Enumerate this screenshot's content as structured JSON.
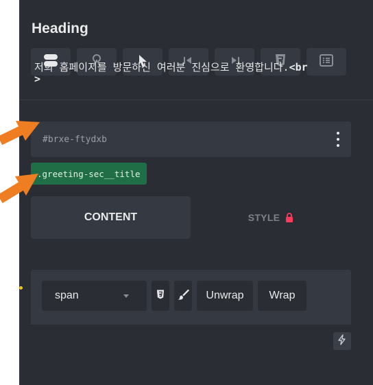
{
  "panel": {
    "heading": "Heading",
    "toolbar_icons": [
      "toggle-icon",
      "hook-icon",
      "cursor-icon",
      "skip-back-icon",
      "skip-forward-icon",
      "css3-icon",
      "list-icon"
    ]
  },
  "element": {
    "id": "#brxe-ftydxb",
    "class_name": ".greeting-sec__title"
  },
  "tabs": {
    "content_label": "CONTENT",
    "style_label": "STYLE"
  },
  "editor": {
    "tag_value": "span",
    "unwrap_label": "Unwrap",
    "wrap_label": "Wrap",
    "text_body": "저희 홈페이지를 방문하신 여러분 진심으로 환영합니다.",
    "text_tag": "<br>"
  },
  "colors": {
    "panel_bg": "#2a2d33",
    "field_bg": "#353941",
    "class_tag": "#1f6e46",
    "lock": "#ff3b5c",
    "annotation_arrow": "#ef7d22"
  }
}
